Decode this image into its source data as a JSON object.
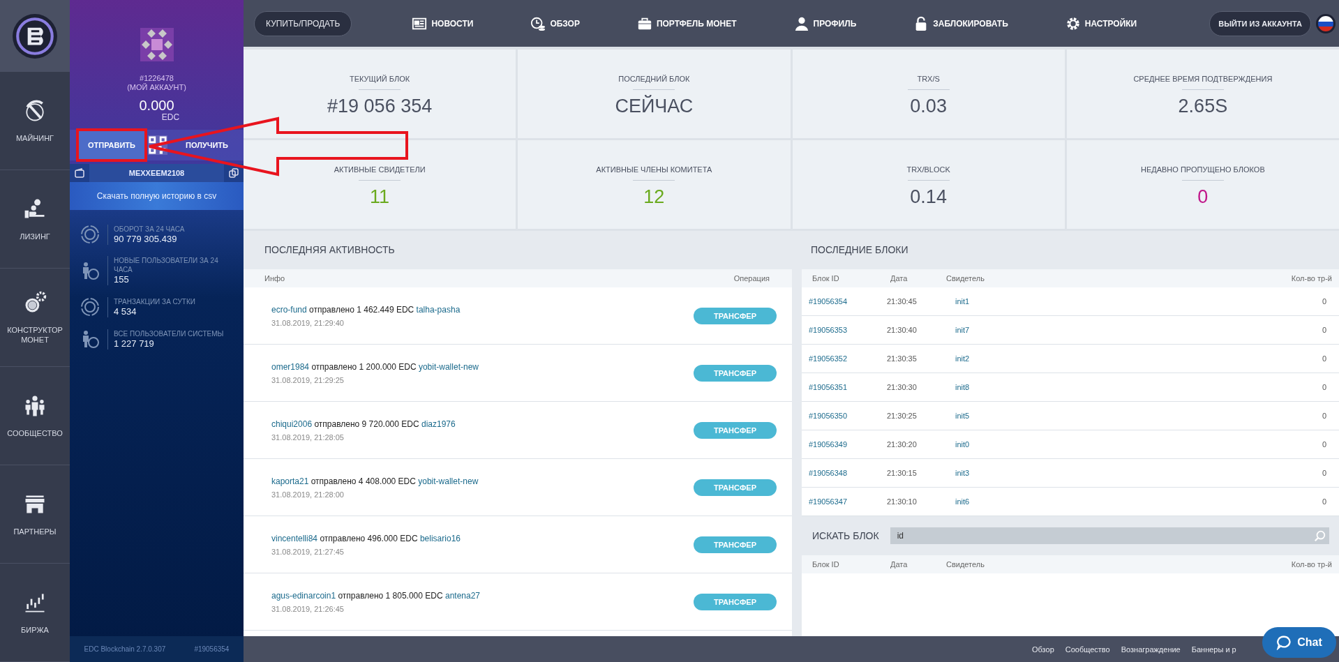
{
  "nav": {
    "items": [
      {
        "label": "МАЙНИНГ"
      },
      {
        "label": "ЛИЗИНГ"
      },
      {
        "label": "КОНСТРУКТОР МОНЕТ"
      },
      {
        "label": "СООБЩЕСТВО"
      },
      {
        "label": "ПАРТНЕРЫ"
      },
      {
        "label": "БИРЖА"
      }
    ]
  },
  "account": {
    "id": "#1226478",
    "note": "(МОЙ АККАУНТ)",
    "balance": "0.000",
    "currency": "EDC",
    "send": "ОТПРАВИТЬ",
    "receive": "ПОЛУЧИТЬ",
    "name": "MEXXEEM2108",
    "download": "Скачать полную историю в csv",
    "stats": [
      {
        "label": "ОБОРОТ ЗА 24 ЧАСА",
        "value": "90 779 305.439"
      },
      {
        "label": "НОВЫЕ ПОЛЬЗОВАТЕЛИ ЗА 24 ЧАСА",
        "value": "155"
      },
      {
        "label": "ТРАНЗАКЦИИ ЗА СУТКИ",
        "value": "4 534"
      },
      {
        "label": "ВСЕ ПОЛЬЗОВАТЕЛИ СИСТЕМЫ",
        "value": "1 227 719"
      }
    ],
    "version": "EDC Blockchain 2.7.0.307",
    "block": "#19056354"
  },
  "topbar": {
    "buy_sell": "КУПИТЬ/ПРОДАТЬ",
    "items": [
      "НОВОСТИ",
      "ОБЗОР",
      "ПОРТФЕЛЬ МОНЕТ",
      "ПРОФИЛЬ",
      "ЗАБЛОКИРОВАТЬ",
      "НАСТРОЙКИ"
    ],
    "logout": "ВЫЙТИ ИЗ АККАУНТА"
  },
  "stats": [
    {
      "label": "ТЕКУЩИЙ БЛОК",
      "value": "#19 056 354",
      "color": "#4a5060"
    },
    {
      "label": "ПОСЛЕДНИЙ БЛОК",
      "value": "СЕЙЧАС",
      "color": "#4a5060"
    },
    {
      "label": "TRX/S",
      "value": "0.03",
      "color": "#4a5060"
    },
    {
      "label": "СРЕДНЕЕ ВРЕМЯ ПОДТВЕРЖДЕНИЯ",
      "value": "2.65S",
      "color": "#4a5060"
    },
    {
      "label": "АКТИВНЫЕ СВИДЕТЕЛИ",
      "value": "11",
      "color": "#6aaa1e"
    },
    {
      "label": "АКТИВНЫЕ ЧЛЕНЫ КОМИТЕТА",
      "value": "12",
      "color": "#6aaa1e"
    },
    {
      "label": "TRX/BLOCK",
      "value": "0.14",
      "color": "#4a5060"
    },
    {
      "label": "НЕДАВНО ПРОПУЩЕНО БЛОКОВ",
      "value": "0",
      "color": "#c0178a"
    }
  ],
  "activity": {
    "title": "ПОСЛЕДНЯЯ АКТИВНОСТЬ",
    "columns": [
      "Инфо",
      "Операция"
    ],
    "rows": [
      {
        "from": "ecro-fund",
        "text": "отправлено 1 462.449 EDC",
        "to": "talha-pasha",
        "time": "31.08.2019, 21:29:40",
        "operation": "ТРАНСФЕР"
      },
      {
        "from": "omer1984",
        "text": "отправлено 1 200.000 EDC",
        "to": "yobit-wallet-new",
        "time": "31.08.2019, 21:29:25",
        "operation": "ТРАНСФЕР"
      },
      {
        "from": "chiqui2006",
        "text": "отправлено 9 720.000 EDC",
        "to": "diaz1976",
        "time": "31.08.2019, 21:28:05",
        "operation": "ТРАНСФЕР"
      },
      {
        "from": "kaporta21",
        "text": "отправлено 4 408.000 EDC",
        "to": "yobit-wallet-new",
        "time": "31.08.2019, 21:28:00",
        "operation": "ТРАНСФЕР"
      },
      {
        "from": "vincentelli84",
        "text": "отправлено 496.000 EDC",
        "to": "belisario16",
        "time": "31.08.2019, 21:27:45",
        "operation": "ТРАНСФЕР"
      },
      {
        "from": "agus-edinarcoin1",
        "text": "отправлено 1 805.000 EDC",
        "to": "antena27",
        "time": "31.08.2019, 21:26:45",
        "operation": "ТРАНСФЕР"
      }
    ]
  },
  "blocks": {
    "title": "ПОСЛЕДНИЕ БЛОКИ",
    "columns": [
      "Блок ID",
      "Дата",
      "Свидетель",
      "Кол-во тр-й"
    ],
    "rows": [
      {
        "id": "#19056354",
        "date": "21:30:45",
        "witness": "init1",
        "count": "0"
      },
      {
        "id": "#19056353",
        "date": "21:30:40",
        "witness": "init7",
        "count": "0"
      },
      {
        "id": "#19056352",
        "date": "21:30:35",
        "witness": "init2",
        "count": "0"
      },
      {
        "id": "#19056351",
        "date": "21:30:30",
        "witness": "init8",
        "count": "0"
      },
      {
        "id": "#19056350",
        "date": "21:30:25",
        "witness": "init5",
        "count": "0"
      },
      {
        "id": "#19056349",
        "date": "21:30:20",
        "witness": "init0",
        "count": "0"
      },
      {
        "id": "#19056348",
        "date": "21:30:15",
        "witness": "init3",
        "count": "0"
      },
      {
        "id": "#19056347",
        "date": "21:30:10",
        "witness": "init6",
        "count": "0"
      }
    ],
    "search": {
      "title": "ИСКАТЬ БЛОК",
      "placeholder": "id"
    },
    "search_columns": [
      "Блок ID",
      "Дата",
      "Свидетель",
      "Кол-во тр-й"
    ]
  },
  "footer": {
    "links": [
      "Обзор",
      "Сообщество",
      "Вознаграждение",
      "Баннеры и р"
    ]
  },
  "chat": {
    "label": "Chat"
  }
}
